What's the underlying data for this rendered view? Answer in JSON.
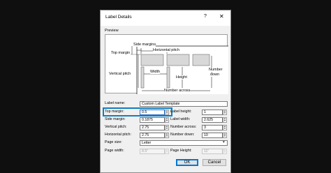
{
  "dialog": {
    "title": "Label Details",
    "help_glyph": "?",
    "close_glyph": "✕"
  },
  "preview": {
    "group_label": "Preview",
    "side_margins": "Side margins",
    "top_margin": "Top margin",
    "horizontal_pitch": "Horizontal pitch",
    "vertical_pitch": "Vertical pitch",
    "width": "Width",
    "height": "Height",
    "number_down_1": "Number",
    "number_down_2": "down",
    "number_across": "Number across"
  },
  "fields": {
    "label_name": {
      "label": "Label name:",
      "value": "Custom Label Template"
    },
    "top_margin": {
      "label": "Top margin:",
      "value": "0.5"
    },
    "side_margin": {
      "label": "Side margin:",
      "value": "0.1875"
    },
    "vertical_pitch": {
      "label": "Vertical pitch:",
      "value": "2.75"
    },
    "horizontal_pitch": {
      "label": "Horizontal pitch:",
      "value": "2.75"
    },
    "page_size": {
      "label": "Page size:",
      "value": "Letter"
    },
    "page_width": {
      "label": "Page width:",
      "value": "8.5\""
    },
    "label_height": {
      "label": "Label height:",
      "value": "1"
    },
    "label_width": {
      "label": "Label width:",
      "value": "2.625"
    },
    "number_across": {
      "label": "Number across:",
      "value": "3"
    },
    "number_down": {
      "label": "Number down:",
      "value": "10"
    },
    "page_height": {
      "label": "Page Height:",
      "value": "11\""
    }
  },
  "buttons": {
    "ok": "OK",
    "cancel": "Cancel"
  },
  "spin_glyphs": {
    "up": "▲",
    "down": "▼",
    "dropdown": "▾"
  },
  "colors": {
    "highlight": "#0d7fc2",
    "dialog_bg": "#f0f0f0",
    "backdrop": "#0f0f0f"
  }
}
